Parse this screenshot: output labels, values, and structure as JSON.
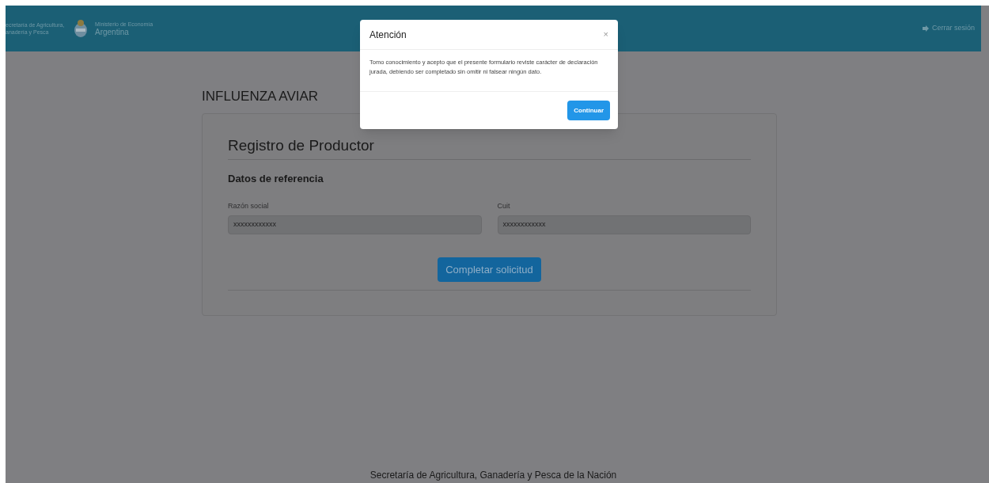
{
  "header": {
    "agency": [
      "ecretaría de Agricultura,",
      "anadería y Pesca"
    ],
    "ministry": [
      "Ministerio de Economía",
      "Argentina"
    ],
    "logout": "Cerrar sesión"
  },
  "page_title": "INFLUENZA AVIAR",
  "form": {
    "title": "Registro de Productor",
    "section": "Datos de referencia",
    "fields": [
      {
        "label": "Razón social",
        "value": "xxxxxxxxxxxx"
      },
      {
        "label": "Cuit",
        "value": "xxxxxxxxxxxx"
      }
    ],
    "submit": "Completar solicitud"
  },
  "modal": {
    "title": "Atención",
    "close": "×",
    "body": "Tomo conocimiento y acepto que el presente formulario reviste carácter de declaración jurada, debiendo ser completado sin omitir ni falsear ningún dato.",
    "button": "Continuar"
  },
  "footer": "Secretaría de Agricultura, Ganadería y Pesca de la Nación"
}
